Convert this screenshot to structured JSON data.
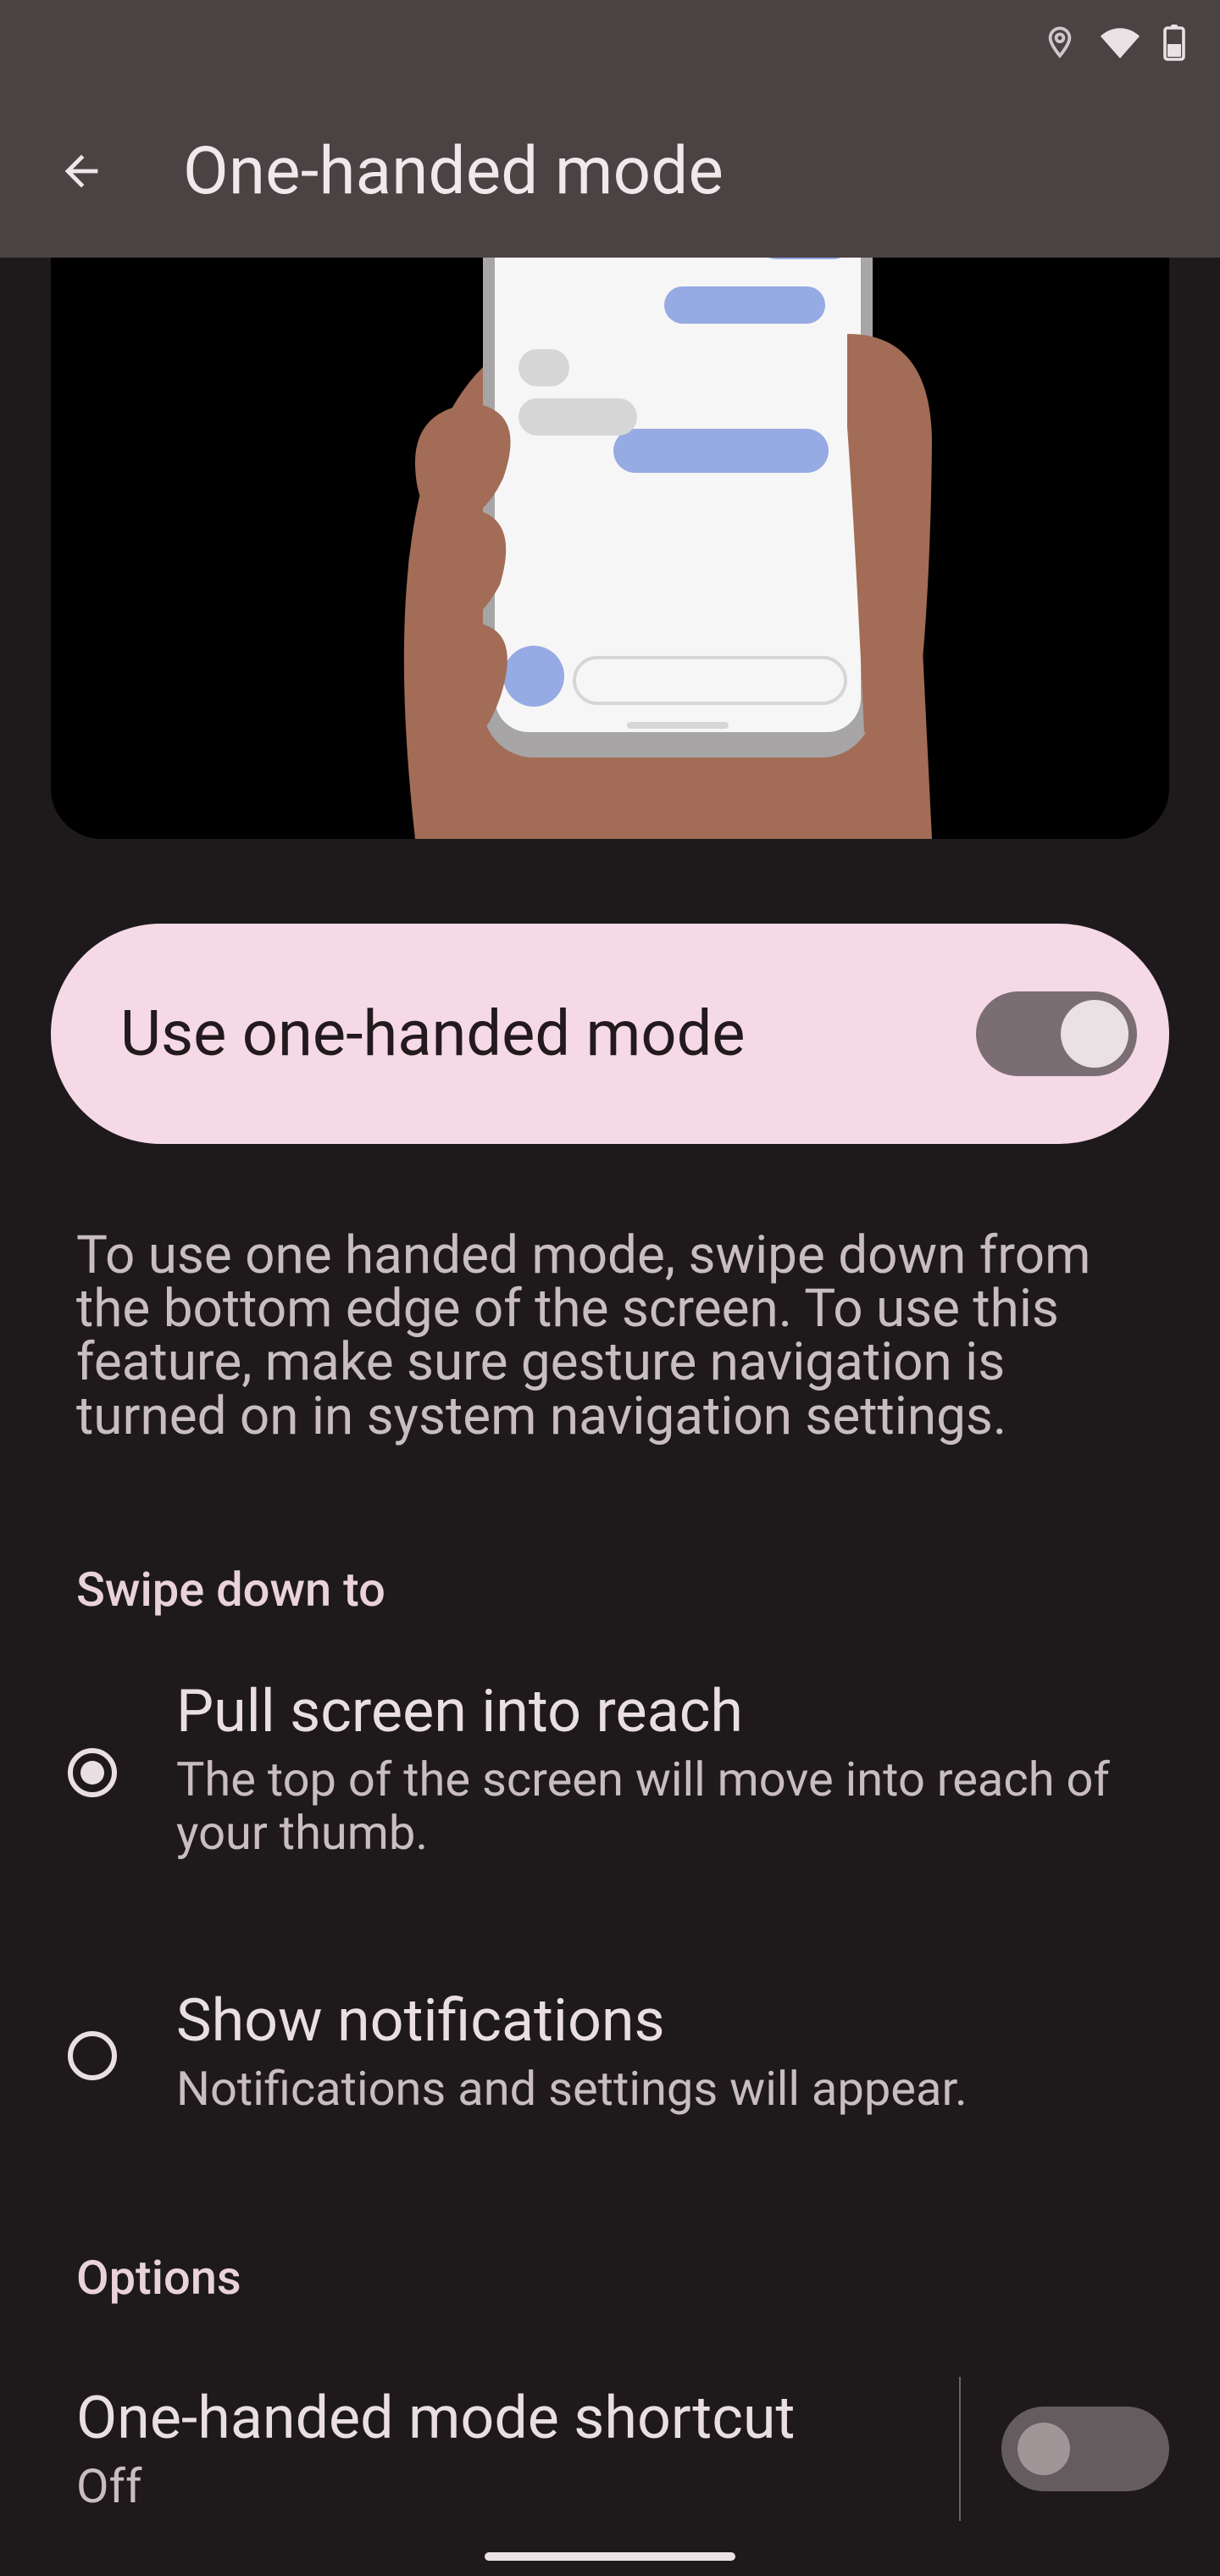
{
  "status": {
    "icons": [
      "location",
      "wifi",
      "battery"
    ]
  },
  "header": {
    "title": "One-handed mode"
  },
  "main_toggle": {
    "label": "Use one-handed mode",
    "checked": true
  },
  "description": "To use one handed mode, swipe down from the bottom edge of the screen. To use this feature, make sure gesture navigation is turned on in system navigation settings.",
  "swipe_down": {
    "section_title": "Swipe down to",
    "options": [
      {
        "title": "Pull screen into reach",
        "subtitle": "The top of the screen will move into reach of your thumb.",
        "selected": true
      },
      {
        "title": "Show notifications",
        "subtitle": "Notifications and settings will appear.",
        "selected": false
      }
    ]
  },
  "options": {
    "section_title": "Options",
    "shortcut": {
      "title": "One-handed mode shortcut",
      "value": "Off",
      "checked": false
    }
  }
}
